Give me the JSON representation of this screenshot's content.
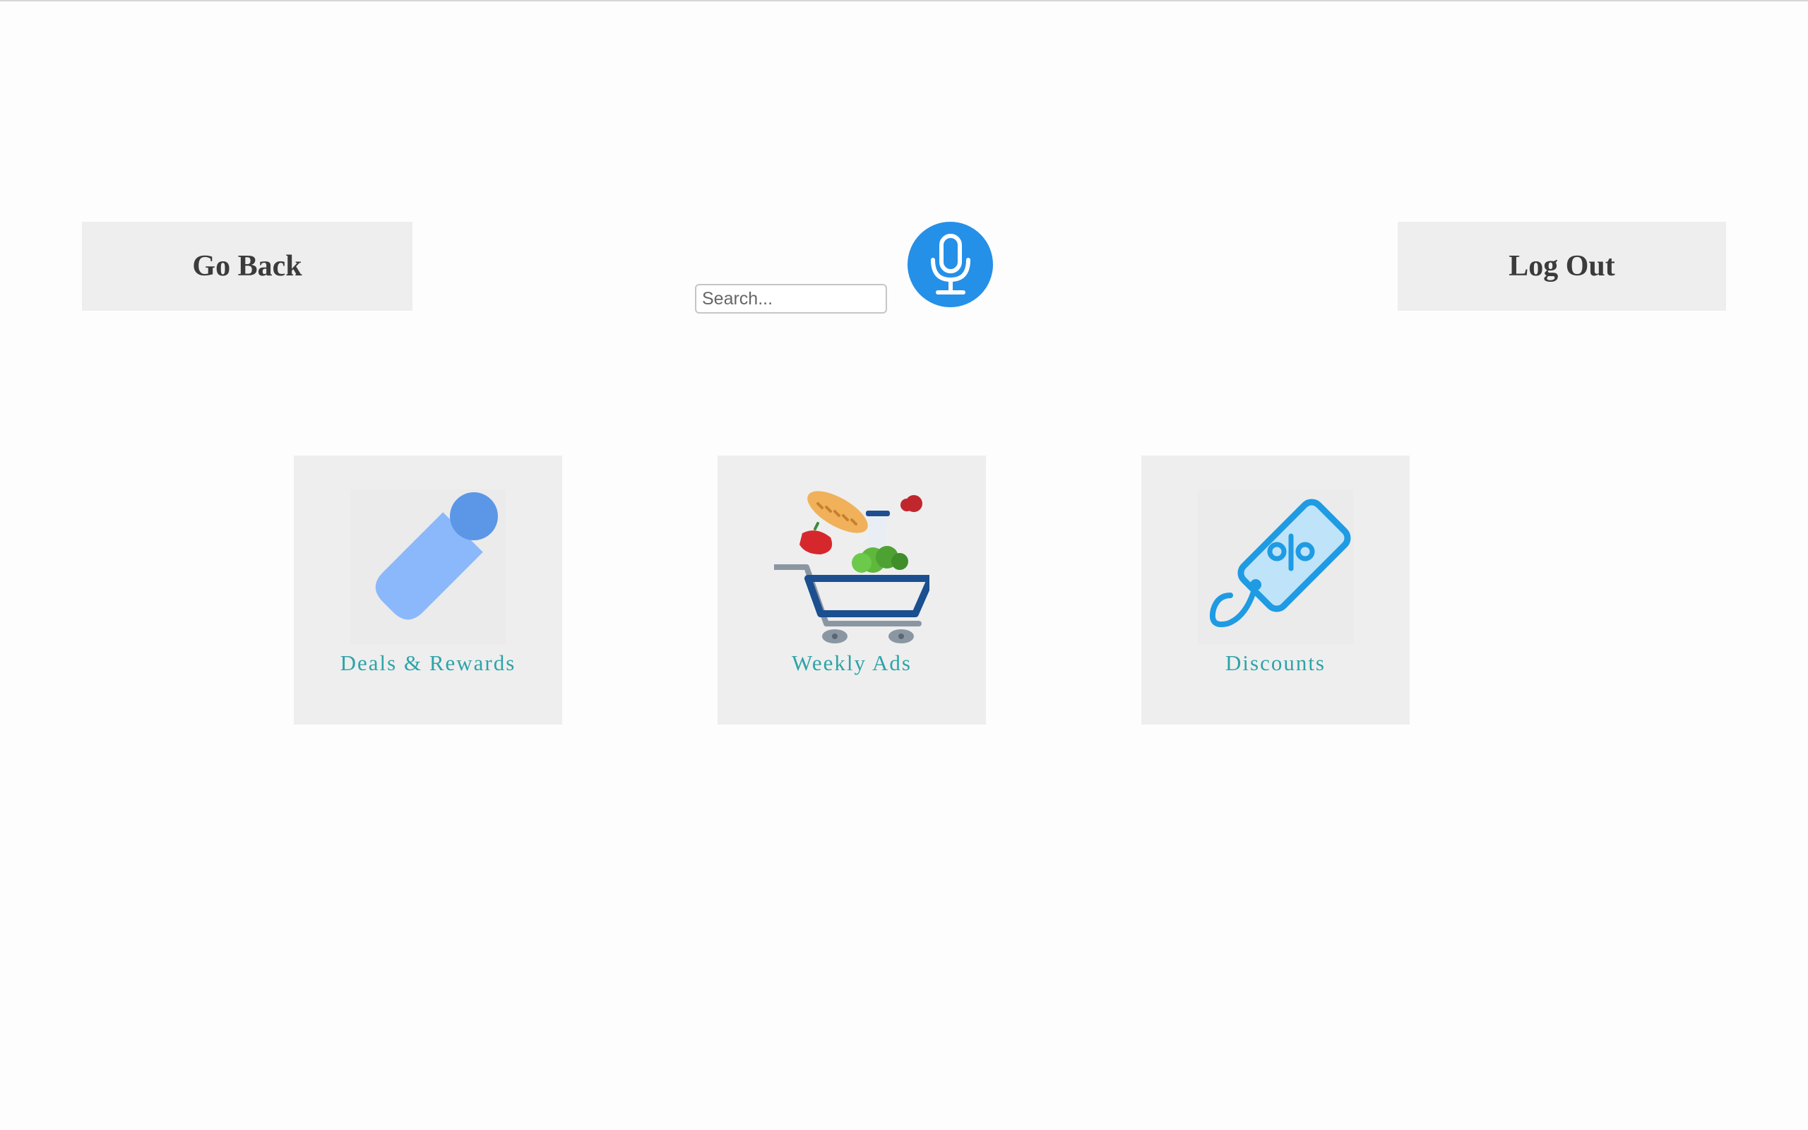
{
  "header": {
    "go_back_label": "Go Back",
    "log_out_label": "Log Out"
  },
  "search": {
    "placeholder": "Search...",
    "value": "",
    "mic_icon": "microphone-icon"
  },
  "tiles": [
    {
      "label": "Deals & Rewards",
      "icon": "price-tag-icon"
    },
    {
      "label": "Weekly Ads",
      "icon": "grocery-cart-icon"
    },
    {
      "label": "Discounts",
      "icon": "discount-tag-icon"
    }
  ],
  "colors": {
    "accent": "#2590e8",
    "tile_label": "#2ea3a8",
    "tile_background": "#eeeeee",
    "button_background": "#eeeeee"
  }
}
